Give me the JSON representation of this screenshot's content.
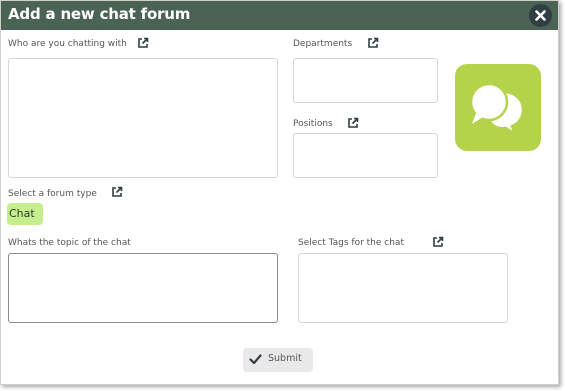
{
  "dialog": {
    "title": "Add a new chat forum",
    "close_icon": "close-icon"
  },
  "fields": {
    "chatting_with_label": "Who are you chatting with",
    "departments_label": "Departments",
    "positions_label": "Positions",
    "forum_type_label": "Select a forum type",
    "forum_type_selected": "Chat",
    "topic_label": "Whats the topic of the chat",
    "tags_label": "Select Tags for the chat"
  },
  "icons": {
    "external_link": "external-link-icon",
    "logo": "chat-bubbles-icon",
    "submit": "check-icon"
  },
  "actions": {
    "submit_label": "Submit"
  },
  "colors": {
    "titlebar": "#4a6355",
    "close_button": "#2f3f44",
    "logo_bg": "#b5d34a",
    "chip_bg": "#c6ee8c"
  }
}
